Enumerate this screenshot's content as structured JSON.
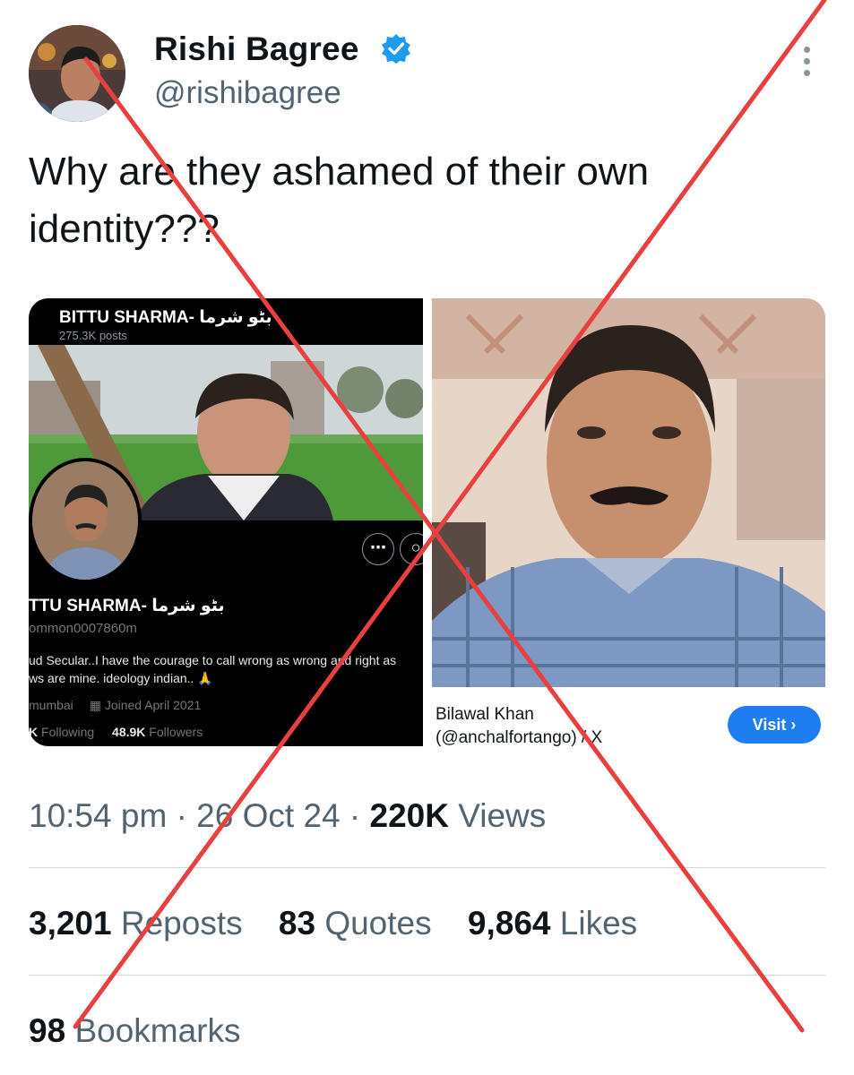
{
  "author": {
    "name": "Rishi Bagree",
    "handle": "@rishibagree",
    "verified_icon": "verified-badge-icon",
    "accent": "#1d9bf0"
  },
  "tweet": {
    "text": "Why are they ashamed of their own identity???"
  },
  "media_left": {
    "profile_name_header": "BITTU SHARMA- بٹو شرما",
    "posts_count": "275.3K posts",
    "profile_name": "TTU SHARMA- بٹو شرما",
    "handle": "ommon0007860m",
    "bio_line1": "ud Secular..I have the courage to call wrong as wrong and right as",
    "bio_line2": "ws are mine.  ideology indian.. 🙏",
    "location": "mumbai",
    "joined": "Joined April 2021",
    "following_count": "K",
    "following_label": "Following",
    "followers_count": "48.9K",
    "followers_label": "Followers"
  },
  "media_right": {
    "caption_name": "Bilawal Khan",
    "caption_handle": "(@anchalfortango) / X",
    "visit_label": "Visit ›"
  },
  "meta": {
    "time": "10:54 pm",
    "date": "26 Oct 24",
    "views_count": "220K",
    "views_label": "Views"
  },
  "stats": {
    "reposts_count": "3,201",
    "reposts_label": "Reposts",
    "quotes_count": "83",
    "quotes_label": "Quotes",
    "likes_count": "9,864",
    "likes_label": "Likes",
    "bookmarks_count": "98",
    "bookmarks_label": "Bookmarks"
  },
  "overlay": {
    "cross_color": "#e8403f"
  }
}
